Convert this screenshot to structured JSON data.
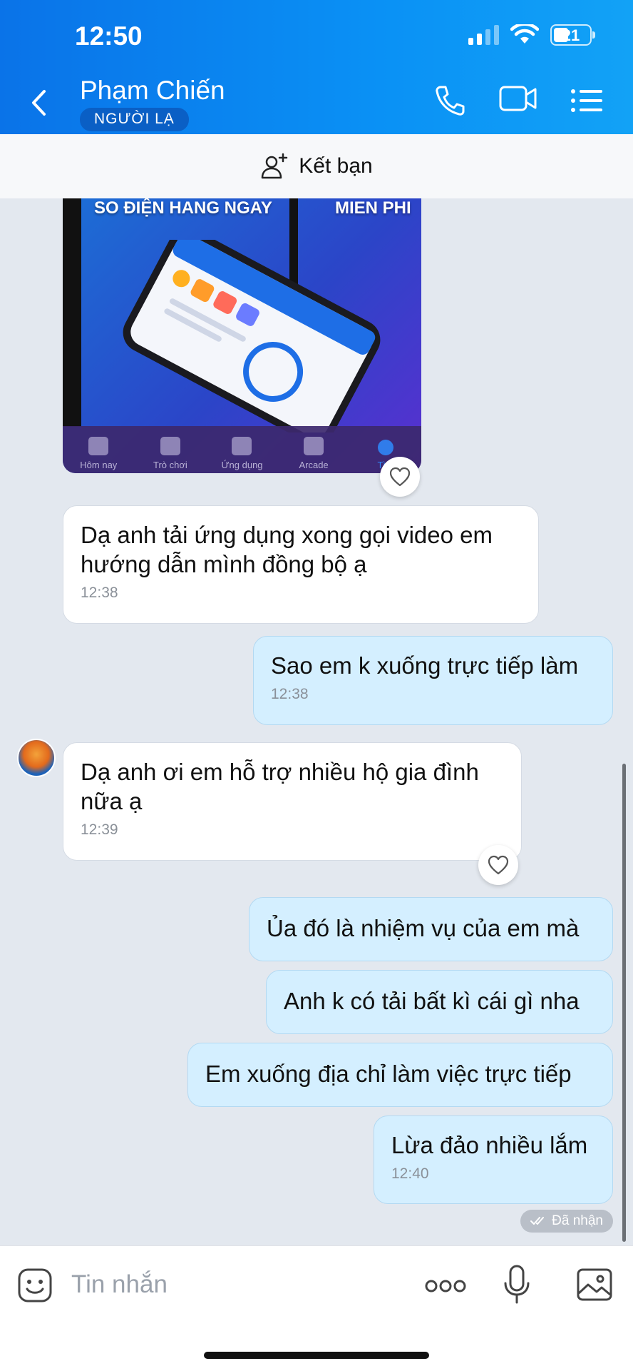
{
  "status": {
    "time": "12:50",
    "battery": "21"
  },
  "header": {
    "name": "Phạm Chiến",
    "badge": "NGƯỜI LẠ"
  },
  "add_friend": {
    "label": "Kết bạn"
  },
  "image_message": {
    "banner_left": "SO ĐIỆN HANG NGAY",
    "banner_right": "MIEN PHI",
    "tabs": [
      "Hôm nay",
      "Trò chơi",
      "Ứng dụng",
      "Arcade",
      "Tìm"
    ]
  },
  "messages": [
    {
      "direction": "in",
      "text": "Dạ anh tải ứng dụng xong gọi video em hướng dẫn mình đồng bộ ạ",
      "time": "12:38"
    },
    {
      "direction": "out",
      "text": "Sao em k xuống trực tiếp làm",
      "time": "12:38"
    },
    {
      "direction": "in",
      "text": "Dạ anh ơi em hỗ trợ nhiều hộ gia đình nữa ạ",
      "time": "12:39"
    },
    {
      "direction": "out",
      "text": "Ủa đó là nhiệm vụ của em mà",
      "time": ""
    },
    {
      "direction": "out",
      "text": "Anh k có tải bất kì cái gì nha",
      "time": ""
    },
    {
      "direction": "out",
      "text": "Em xuống địa chỉ làm việc trực tiếp",
      "time": ""
    },
    {
      "direction": "out",
      "text": "Lừa đảo nhiều lắm",
      "time": "12:40"
    }
  ],
  "seen_label": "Đã nhận",
  "input": {
    "placeholder": "Tin nhắn"
  },
  "colors": {
    "header": "#0a85f0",
    "out_bubble": "#d4efff",
    "background": "#e3e8ef"
  }
}
